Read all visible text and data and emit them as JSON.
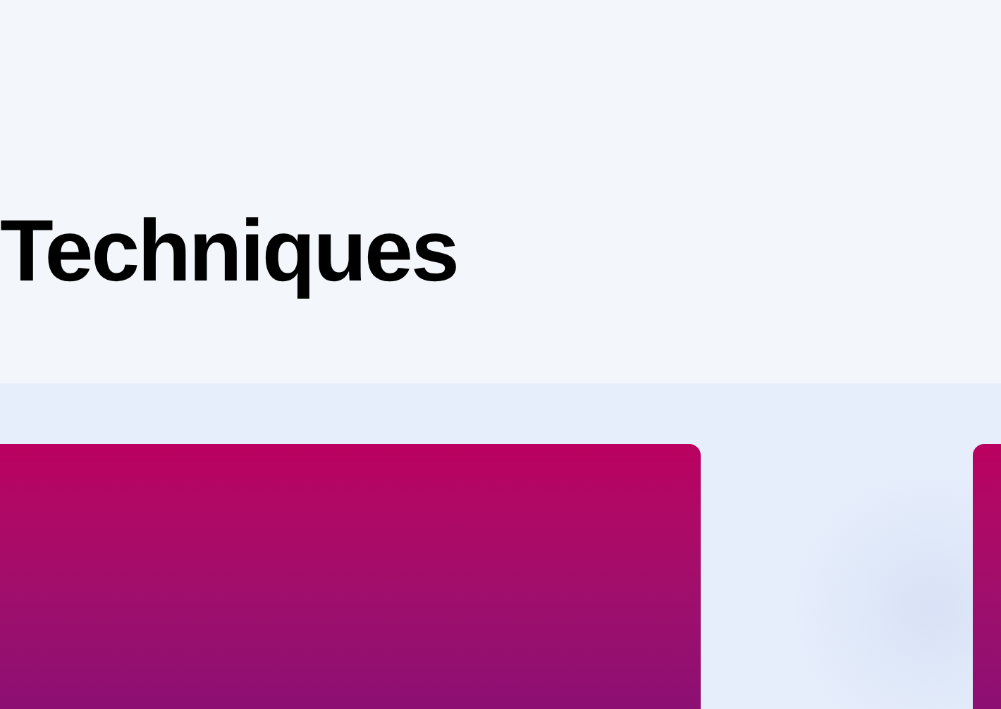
{
  "section": {
    "heading": "Techniques"
  },
  "cards": [
    {
      "kind": "gradient"
    },
    {
      "kind": "gradient"
    }
  ]
}
